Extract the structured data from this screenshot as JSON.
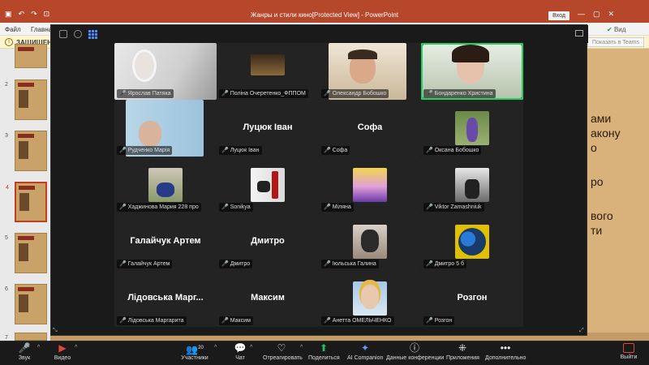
{
  "powerpoint": {
    "title": "Жанры и стили кино[Protected View] - PowerPoint",
    "signin_label": "Вход",
    "ribbon": {
      "file": "Файл",
      "home": "Главна"
    },
    "warning_text": "ЗАЩИЩЕН",
    "teams_button": "Показать в Teams",
    "view_label": "Вид",
    "thumbnails": [
      "2",
      "3",
      "4",
      "5",
      "6",
      "7"
    ],
    "active_slide": "4",
    "slide_text": [
      "ами",
      "акону",
      "о",
      "ро",
      "вого",
      "ти"
    ],
    "colors": {
      "accent": "#b7472a",
      "slide_bg": "#d8b27a"
    }
  },
  "zoom": {
    "participants": [
      {
        "name": "Ярослав Патяка",
        "big": "",
        "video": true,
        "speaking": false
      },
      {
        "name": "Поліна Очеретенко_ФППОМ",
        "big": "",
        "video": true,
        "speaking": false
      },
      {
        "name": "Олександр Бобошко",
        "big": "",
        "video": true,
        "speaking": false
      },
      {
        "name": "Бондаренко Христина",
        "big": "",
        "video": true,
        "speaking": true
      },
      {
        "name": "Рудченко Марія",
        "big": "",
        "video": true,
        "speaking": false
      },
      {
        "name": "Луцюк Іван",
        "big": "Луцюк Іван",
        "video": false,
        "speaking": false
      },
      {
        "name": "Софа",
        "big": "Софа",
        "video": false,
        "speaking": false
      },
      {
        "name": "Оксана Бобошко",
        "big": "",
        "video": true,
        "speaking": false
      },
      {
        "name": "Хаджинова Мария 228 про",
        "big": "",
        "video": true,
        "speaking": false
      },
      {
        "name": "Sonikya",
        "big": "",
        "video": true,
        "speaking": false
      },
      {
        "name": "Міляна",
        "big": "",
        "video": true,
        "speaking": false
      },
      {
        "name": "Viktor Zamashniuk",
        "big": "",
        "video": true,
        "speaking": false
      },
      {
        "name": "Галайчук Артем",
        "big": "Галайчук Артем",
        "video": false,
        "speaking": false
      },
      {
        "name": "Дмитро",
        "big": "Дмитро",
        "video": false,
        "speaking": false
      },
      {
        "name": "Іюльська Галина",
        "big": "",
        "video": true,
        "speaking": false
      },
      {
        "name": "Дмитро 5 б",
        "big": "",
        "video": true,
        "speaking": false
      },
      {
        "name": "Лідовська Маргарита",
        "big": "Лідовська Марг...",
        "video": false,
        "speaking": false
      },
      {
        "name": "Максим",
        "big": "Максим",
        "video": false,
        "speaking": false
      },
      {
        "name": "Анетта ОМЕЛЬЧЕНКО",
        "big": "",
        "video": true,
        "speaking": false
      },
      {
        "name": "Розгон",
        "big": "Розгон",
        "video": false,
        "speaking": false
      }
    ],
    "toolbar": {
      "audio": "Звук",
      "video": "Видео",
      "participants": "Участники",
      "participants_count": "20",
      "chat": "Чат",
      "react": "Отреагировать",
      "share": "Поделиться",
      "ai": "AI Companion",
      "info": "Данные конференции",
      "apps": "Приложения",
      "more": "Дополнительно",
      "leave": "Выйти"
    },
    "colors": {
      "speaking": "#23d160",
      "muted": "#e0463c",
      "share": "#21c25e"
    }
  }
}
